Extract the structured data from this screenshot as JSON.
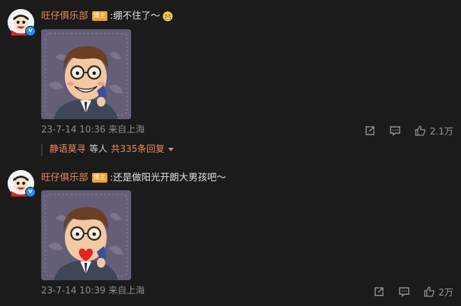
{
  "comments": [
    {
      "username": "旺仔俱乐部",
      "badge": "博主",
      "text": ":绷不住了～",
      "emoji": "grin-emoji",
      "timestamp": "23-7-14 10:36",
      "location": "来自上海",
      "likes": "2.1万",
      "sticker": "cartoon-man-glasses-sticker"
    },
    {
      "username": "旺仔俱乐部",
      "badge": "博主",
      "text": ":还是做阳光开朗大男孩吧～",
      "timestamp": "23-7-14 10:39",
      "location": "来自上海",
      "likes": "2万",
      "sticker": "cartoon-man-heart-sticker"
    }
  ],
  "reply_preview": {
    "name": "静语莫寻",
    "connector": "等人",
    "count": "共335条回复"
  },
  "icons": {
    "share": "share-icon",
    "comment": "comment-icon",
    "like": "thumbs-up-icon",
    "verified": "verified-icon"
  },
  "colors": {
    "background": "#1b1b1b",
    "username": "#ef8a5a",
    "badge": "#f1a12a",
    "verified": "#1f8fff",
    "meta": "#8d8d8d"
  }
}
